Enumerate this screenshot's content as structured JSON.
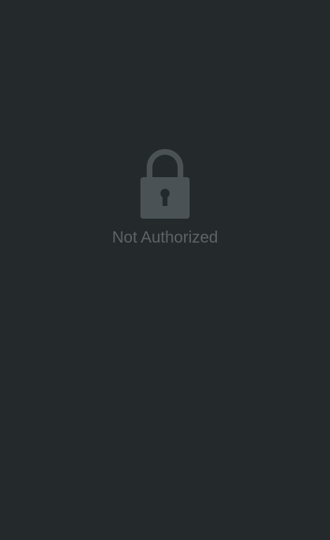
{
  "state": {
    "icon": "lock-icon",
    "message": "Not Authorized"
  },
  "colors": {
    "background": "#24292c",
    "icon": "#4b5256",
    "text": "#5d6468"
  }
}
